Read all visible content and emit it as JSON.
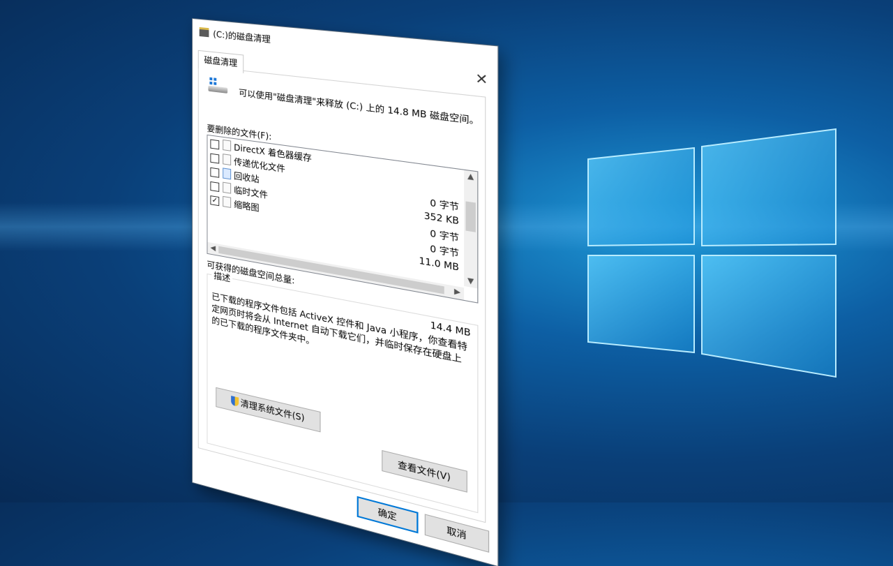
{
  "window": {
    "title": "(C:)的磁盘清理",
    "close_glyph": "✕"
  },
  "tab": {
    "label": "磁盘清理"
  },
  "intro_text": "可以使用\"磁盘清理\"来释放  (C:) 上的 14.8 MB 磁盘空间。",
  "files_label": "要删除的文件(F):",
  "files": [
    {
      "name": "DirectX 着色器缓存",
      "checked": false,
      "icon": "file-icon",
      "size": "0 字节"
    },
    {
      "name": "传递优化文件",
      "checked": false,
      "icon": "file-icon",
      "size": "352 KB"
    },
    {
      "name": "回收站",
      "checked": false,
      "icon": "recycle-bin-icon",
      "size": "0 字节"
    },
    {
      "name": "临时文件",
      "checked": false,
      "icon": "file-icon",
      "size": "0 字节"
    },
    {
      "name": "缩略图",
      "checked": true,
      "icon": "file-icon",
      "size": "11.0 MB"
    }
  ],
  "total_label": "可获得的磁盘空间总量:",
  "total_value": "14.4 MB",
  "description": {
    "title": "描述",
    "text": "已下载的程序文件包括 ActiveX 控件和 Java 小程序，你查看特定网页时将会从 Internet 自动下载它们，并临时保存在硬盘上的已下载的程序文件夹中。"
  },
  "buttons": {
    "clean_system": "清理系统文件(S)",
    "view_files": "查看文件(V)",
    "ok": "确定",
    "cancel": "取消"
  },
  "check_glyph": "✓"
}
